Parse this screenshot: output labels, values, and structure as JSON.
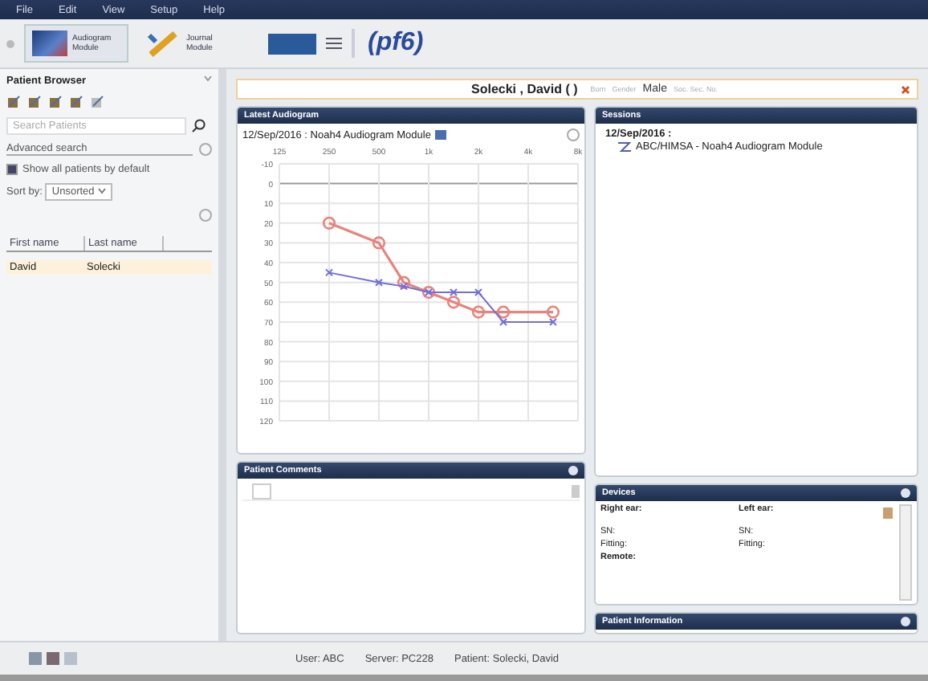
{
  "menu": [
    "File",
    "Edit",
    "View",
    "Setup",
    "Help"
  ],
  "modules": [
    {
      "label": "Audiogram Module",
      "selected": true
    },
    {
      "label": "Journal Module",
      "selected": false
    }
  ],
  "logo": "(pf6)",
  "patient_browser": {
    "title": "Patient Browser",
    "search": {
      "placeholder": "Search Patients"
    },
    "advanced_search": "Advanced search",
    "show_all": {
      "label": "Show all patients by default",
      "checked": true
    },
    "sort_label": "Sort by:",
    "sort_value": "Unsorted",
    "columns": [
      "First name",
      "Last name"
    ],
    "rows": [
      {
        "first": "David",
        "last": "Solecki",
        "selected": true
      }
    ]
  },
  "patient_bar": {
    "name": "Solecki , David ( )",
    "born_label": "Born",
    "gender_label": "Gender",
    "gender": "Male",
    "ssn_label": "Soc. Sec. No."
  },
  "audiogram": {
    "title": "Latest Audiogram",
    "subtitle": "12/Sep/2016 : Noah4 Audiogram Module",
    "chart_data": {
      "type": "line",
      "grid": true,
      "categories": [
        "125",
        null,
        "250",
        null,
        "500",
        null,
        "1k",
        null,
        "2k",
        null,
        "4k",
        null,
        "8k"
      ],
      "ylim": [
        120,
        -10
      ],
      "yticks": [
        -10,
        0,
        10,
        20,
        30,
        40,
        50,
        60,
        70,
        80,
        90,
        100,
        110,
        120
      ],
      "series": [
        {
          "color": "#e8837c",
          "marker": "circle",
          "values": [
            null,
            null,
            20,
            null,
            30,
            50,
            55,
            60,
            65,
            65,
            null,
            65,
            null
          ]
        },
        {
          "color": "#6f6fd8",
          "marker": "x",
          "values": [
            null,
            null,
            45,
            null,
            50,
            52,
            55,
            55,
            55,
            70,
            null,
            70,
            null
          ]
        }
      ]
    }
  },
  "sessions": {
    "title": "Sessions",
    "date": "12/Sep/2016 :",
    "entry": "ABC/HIMSA  -  Noah4 Audiogram Module"
  },
  "comments": {
    "title": "Patient Comments"
  },
  "devices": {
    "title": "Devices",
    "right": "Right ear:",
    "left": "Left ear:",
    "rows": [
      {
        "right": "SN:",
        "left": "SN:"
      },
      {
        "right": "Fitting:",
        "left": "Fitting:"
      }
    ],
    "remote": "Remote:"
  },
  "patient_information": {
    "title": "Patient Information"
  },
  "status_bar": [
    "User: ABC",
    "Server: PC228",
    "Patient: Solecki, David"
  ]
}
